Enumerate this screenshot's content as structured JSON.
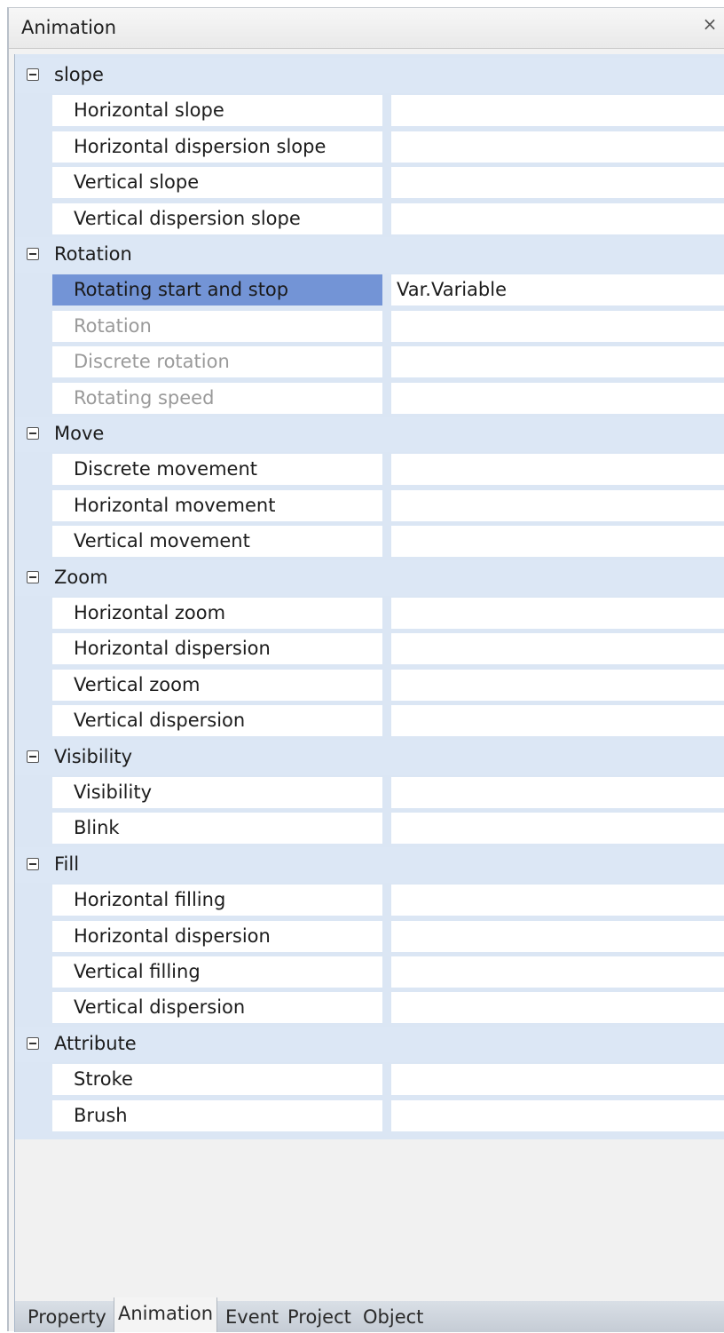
{
  "window": {
    "title": "Animation",
    "close_glyph": "×"
  },
  "categories": [
    {
      "label": "slope",
      "rows": [
        {
          "name": "Horizontal slope",
          "value": ""
        },
        {
          "name": "Horizontal dispersion slope",
          "value": ""
        },
        {
          "name": "Vertical slope",
          "value": ""
        },
        {
          "name": "Vertical dispersion slope",
          "value": ""
        }
      ]
    },
    {
      "label": "Rotation",
      "rows": [
        {
          "name": "Rotating start and stop",
          "value": "Var.Variable",
          "selected": true
        },
        {
          "name": "Rotation",
          "value": "",
          "disabled": true
        },
        {
          "name": "Discrete rotation",
          "value": "",
          "disabled": true
        },
        {
          "name": "Rotating speed",
          "value": "",
          "disabled": true
        }
      ]
    },
    {
      "label": "Move",
      "rows": [
        {
          "name": "Discrete movement",
          "value": ""
        },
        {
          "name": "Horizontal movement",
          "value": ""
        },
        {
          "name": "Vertical movement",
          "value": ""
        }
      ]
    },
    {
      "label": "Zoom",
      "rows": [
        {
          "name": "Horizontal zoom",
          "value": ""
        },
        {
          "name": "Horizontal dispersion",
          "value": ""
        },
        {
          "name": "Vertical zoom",
          "value": ""
        },
        {
          "name": "Vertical dispersion",
          "value": ""
        }
      ]
    },
    {
      "label": "Visibility",
      "rows": [
        {
          "name": "Visibility",
          "value": ""
        },
        {
          "name": "Blink",
          "value": ""
        }
      ]
    },
    {
      "label": "Fill",
      "rows": [
        {
          "name": "Horizontal filling",
          "value": ""
        },
        {
          "name": "Horizontal dispersion",
          "value": ""
        },
        {
          "name": "Vertical filling",
          "value": ""
        },
        {
          "name": "Vertical dispersion",
          "value": ""
        }
      ]
    },
    {
      "label": "Attribute",
      "rows": [
        {
          "name": "Stroke",
          "value": ""
        },
        {
          "name": "Brush",
          "value": ""
        }
      ]
    }
  ],
  "tabs": [
    {
      "label": "Property",
      "active": false
    },
    {
      "label": "Animation",
      "active": true
    },
    {
      "label": "Event",
      "active": false
    },
    {
      "label": "Project",
      "active": false
    },
    {
      "label": "Object",
      "active": false
    }
  ],
  "icons": {
    "collapse": "minus-box-icon",
    "close": "close-icon"
  },
  "colors": {
    "selection": "#7394d6",
    "category_bg": "#dce7f5",
    "disabled_text": "#9a9a9a"
  }
}
